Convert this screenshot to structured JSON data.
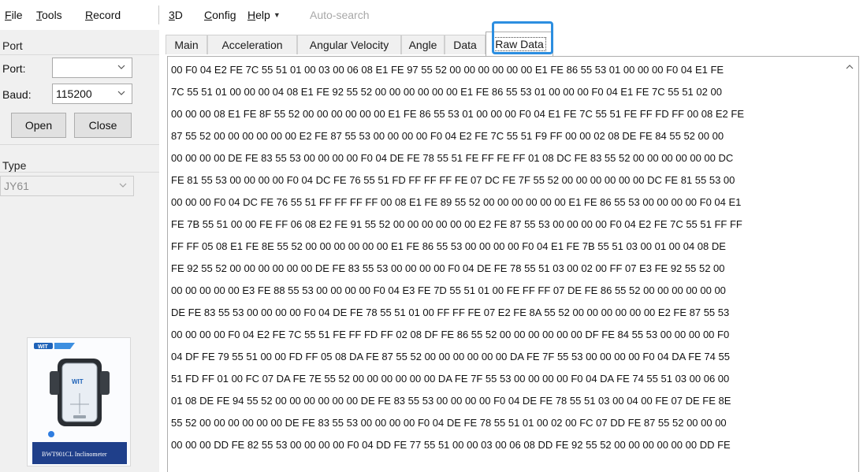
{
  "menu": {
    "file": {
      "u": "F",
      "rest": "ile"
    },
    "tools": {
      "u": "T",
      "rest": "ools"
    },
    "record": {
      "u": "R",
      "rest": "ecord"
    },
    "threed": {
      "u": "3",
      "rest": "D"
    },
    "config": {
      "u": "C",
      "rest": "onfig"
    },
    "help": {
      "u": "H",
      "rest": "elp"
    },
    "autosearch": "Auto-search"
  },
  "port_group": {
    "title": "Port",
    "port_label": "Port:",
    "port_value": "",
    "baud_label": "Baud:",
    "baud_value": "115200",
    "open_label": "Open",
    "close_label": "Close"
  },
  "type_group": {
    "title": "Type",
    "value": "JY61"
  },
  "product_image": {
    "caption": "BWT901CL Inclinometer"
  },
  "tabs": [
    {
      "label": "Main"
    },
    {
      "label": "Acceleration"
    },
    {
      "label": "Angular Velocity"
    },
    {
      "label": "Angle"
    },
    {
      "label": "Data"
    },
    {
      "label": "Raw Data"
    }
  ],
  "active_tab": "Raw Data",
  "colors": {
    "highlight": "#2c8ee0",
    "panel_bg": "#f0f0f0"
  },
  "raw_lines": [
    "00 F0 04 E2 FE 7C 55 51 01 00 03 00 06 08 E1 FE 97 55 52 00 00 00 00 00 00 E1 FE 86 55 53 01 00 00 00 F0 04 E1 FE",
    "7C 55 51 01 00 00 00 04 08 E1 FE 92 55 52 00 00 00 00 00 00 E1 FE 86 55 53 01 00 00 00 F0 04 E1 FE 7C 55 51 02 00",
    "00 00 00 08 E1 FE 8F 55 52 00 00 00 00 00 00 E1 FE 86 55 53 01 00 00 00 F0 04 E1 FE 7C 55 51 FE FF FD FF 00 08 E2 FE",
    "87 55 52 00 00 00 00 00 00 E2 FE 87 55 53 00 00 00 00 F0 04 E2 FE 7C 55 51 F9 FF 00 00 02 08 DE FE 84 55 52 00 00",
    "00 00 00 00 DE FE 83 55 53 00 00 00 00 F0 04 DE FE 78 55 51 FE FF FE FF 01 08 DC FE 83 55 52 00 00 00 00 00 00 DC",
    "FE 81 55 53 00 00 00 00 F0 04 DC FE 76 55 51 FD FF FF FF FE 07 DC FE 7F 55 52 00 00 00 00 00 00 DC FE 81 55 53 00",
    "00 00 00 F0 04 DC FE 76 55 51 FF FF FF FF 00 08 E1 FE 89 55 52 00 00 00 00 00 00 E1 FE 86 55 53 00 00 00 00 F0 04 E1",
    "FE 7B 55 51 00 00 FE FF 06 08 E2 FE 91 55 52 00 00 00 00 00 00 E2 FE 87 55 53 00 00 00 00 F0 04 E2 FE 7C 55 51 FF FF",
    "FF FF 05 08 E1 FE 8E 55 52 00 00 00 00 00 00 E1 FE 86 55 53 00 00 00 00 F0 04 E1 FE 7B 55 51 03 00 01 00 04 08 DE",
    "FE 92 55 52 00 00 00 00 00 00 DE FE 83 55 53 00 00 00 00 F0 04 DE FE 78 55 51 03 00 02 00 FF 07 E3 FE 92 55 52 00",
    "00 00 00 00 00 E3 FE 88 55 53 00 00 00 00 F0 04 E3 FE 7D 55 51 01 00 FE FF FF 07 DE FE 86 55 52 00 00 00 00 00 00",
    "DE FE 83 55 53 00 00 00 00 F0 04 DE FE 78 55 51 01 00 FF FF FE 07 E2 FE 8A 55 52 00 00 00 00 00 00 E2 FE 87 55 53",
    "00 00 00 00 F0 04 E2 FE 7C 55 51 FE FF FD FF 02 08 DF FE 86 55 52 00 00 00 00 00 00 DF FE 84 55 53 00 00 00 00 F0",
    "04 DF FE 79 55 51 00 00 FD FF 05 08 DA FE 87 55 52 00 00 00 00 00 00 DA FE 7F 55 53 00 00 00 00 F0 04 DA FE 74 55",
    "51 FD FF 01 00 FC 07 DA FE 7E 55 52 00 00 00 00 00 00 DA FE 7F 55 53 00 00 00 00 F0 04 DA FE 74 55 51 03 00 06 00",
    "01 08 DE FE 94 55 52 00 00 00 00 00 00 DE FE 83 55 53 00 00 00 00 F0 04 DE FE 78 55 51 03 00 04 00 FE 07 DE FE 8E",
    "55 52 00 00 00 00 00 00 DE FE 83 55 53 00 00 00 00 F0 04 DE FE 78 55 51 01 00 02 00 FC 07 DD FE 87 55 52 00 00 00",
    "00 00 00 DD FE 82 55 53 00 00 00 00 F0 04 DD FE 77 55 51 00 00 03 00 06 08 DD FE 92 55 52 00 00 00 00 00 00 DD FE"
  ]
}
